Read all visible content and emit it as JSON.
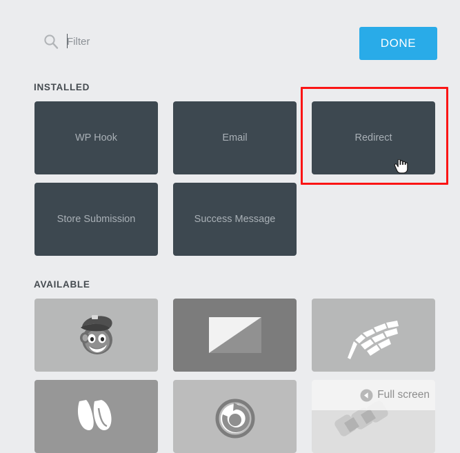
{
  "toolbar": {
    "search_icon": "search-icon",
    "search_placeholder": "Filter",
    "search_value": "",
    "done_label": "DONE",
    "done_color": "#29abe8"
  },
  "sections": [
    {
      "id": "installed",
      "title": "INSTALLED",
      "card_color": "#3d4850",
      "cards": [
        {
          "label": "WP Hook",
          "type": "text"
        },
        {
          "label": "Email",
          "type": "text"
        },
        {
          "label": "Redirect",
          "type": "text",
          "highlighted": true
        },
        {
          "label": "Store Submission",
          "type": "text"
        },
        {
          "label": "Success Message",
          "type": "text"
        }
      ]
    },
    {
      "id": "available",
      "title": "AVAILABLE",
      "cards": [
        {
          "icon": "mailchimp-monkey-icon",
          "bg": "#b7b8b8"
        },
        {
          "icon": "paper-plane-icon",
          "bg": "#7c7c7c"
        },
        {
          "icon": "checkered-flag-icon",
          "bg": "#b7b8b8"
        },
        {
          "icon": "w-letter-icon",
          "bg": "#979797"
        },
        {
          "icon": "swirl-circle-icon",
          "bg": "#bcbcbc"
        },
        {
          "icon": "puzzle-pieces-icon",
          "bg": "#dedede"
        }
      ]
    }
  ],
  "annotation": {
    "name": "redirect-highlight-box",
    "color": "#fb1414"
  },
  "cursor": {
    "name": "pointing-hand-cursor"
  },
  "overlay": {
    "collapse_icon": "collapse-left-icon",
    "label": "Full screen"
  },
  "page": {
    "background": "#ebecee"
  }
}
